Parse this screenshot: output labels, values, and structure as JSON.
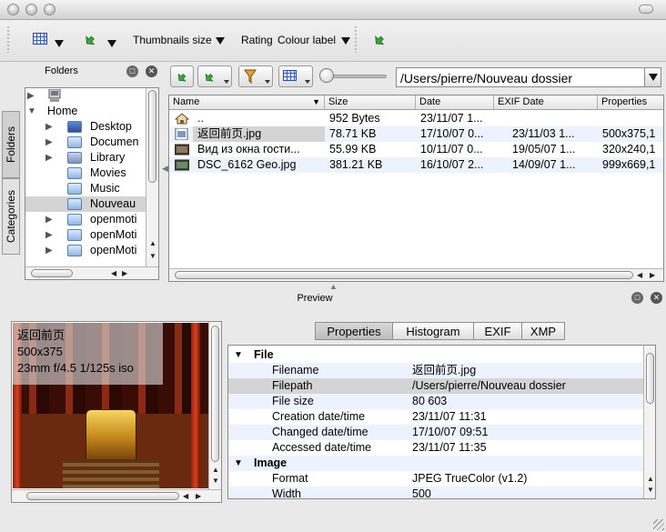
{
  "toolbar": {
    "thumbnails_size_label": "Thumbnails size",
    "rating_label": "Rating",
    "colour_label": "Colour label"
  },
  "folders_panel": {
    "title": "Folders",
    "tab_folders": "Folders",
    "tab_categories": "Categories",
    "items": [
      {
        "label": "",
        "icon": "computer-icon"
      },
      {
        "label": "Home",
        "icon": "none"
      },
      {
        "label": "Desktop",
        "icon": "desktop-folder-icon"
      },
      {
        "label": "Documen",
        "icon": "folder-icon"
      },
      {
        "label": "Library",
        "icon": "library-folder-icon"
      },
      {
        "label": "Movies",
        "icon": "folder-icon"
      },
      {
        "label": "Music",
        "icon": "folder-icon"
      },
      {
        "label": "Nouveau",
        "icon": "folder-icon"
      },
      {
        "label": "openmoti",
        "icon": "folder-icon"
      },
      {
        "label": "openMoti",
        "icon": "folder-icon"
      },
      {
        "label": "openMoti",
        "icon": "folder-icon"
      }
    ]
  },
  "browser": {
    "path": "/Users/pierre/Nouveau dossier",
    "columns": [
      "Name",
      "Size",
      "Date",
      "EXIF Date",
      "Properties"
    ],
    "rows": [
      {
        "name": "..",
        "size": "952 Bytes",
        "date": "23/11/07 1...",
        "exif": "",
        "props": "",
        "icon": "home-folder-icon"
      },
      {
        "name": "返回前页.jpg",
        "size": "78.71 KB",
        "date": "17/10/07 0...",
        "exif": "23/11/03 1...",
        "props": "500x375,1",
        "icon": "image-file-icon"
      },
      {
        "name": "Вид из окна гости...",
        "size": "55.99 KB",
        "date": "10/11/07 0...",
        "exif": "19/05/07 1...",
        "props": "320x240,1",
        "icon": "image-file-icon"
      },
      {
        "name": "DSC_6162 Geo.jpg",
        "size": "381.21 KB",
        "date": "16/10/07 2...",
        "exif": "14/09/07 1...",
        "props": "999x669,1",
        "icon": "image-file-icon"
      }
    ]
  },
  "preview": {
    "title": "Preview",
    "overlay_line1": "返回前页",
    "overlay_line2": "500x375",
    "overlay_line3": "23mm f/4.5 1/125s iso"
  },
  "properties": {
    "tabs": [
      "Properties",
      "Histogram",
      "EXIF",
      "XMP"
    ],
    "rows": [
      {
        "type": "group",
        "key": "File",
        "value": ""
      },
      {
        "type": "item",
        "key": "Filename",
        "value": "返回前页.jpg"
      },
      {
        "type": "item",
        "key": "Filepath",
        "value": "/Users/pierre/Nouveau dossier"
      },
      {
        "type": "item",
        "key": "File size",
        "value": "80 603"
      },
      {
        "type": "item",
        "key": "Creation date/time",
        "value": "23/11/07 11:31"
      },
      {
        "type": "item",
        "key": "Changed date/time",
        "value": "17/10/07 09:51"
      },
      {
        "type": "item",
        "key": "Accessed date/time",
        "value": "23/11/07 11:35"
      },
      {
        "type": "group",
        "key": "Image",
        "value": ""
      },
      {
        "type": "item",
        "key": "Format",
        "value": "JPEG TrueColor (v1.2)"
      },
      {
        "type": "item",
        "key": "Width",
        "value": "500"
      }
    ]
  }
}
